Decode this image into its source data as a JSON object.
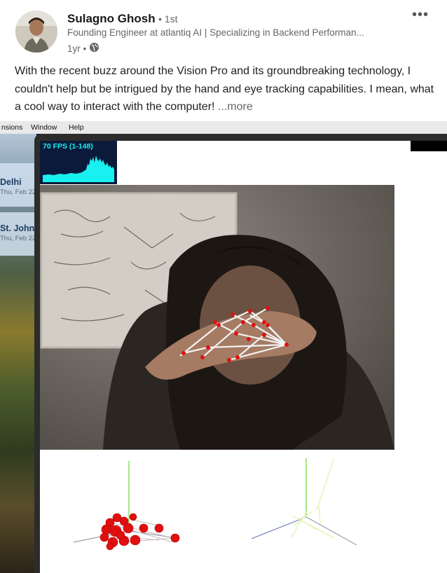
{
  "author": {
    "name": "Sulagno Ghosh",
    "degree": "• 1st",
    "headline": "Founding Engineer at atlantiq AI | Specializing in Backend Performan...",
    "time": "1yr •"
  },
  "post": {
    "text": "With the recent buzz around the Vision Pro and its groundbreaking technology, I couldn't help but be intrigued by the hand and eye tracking capabilities. I mean, what a cool way to interact with the computer!",
    "see_more": "...more"
  },
  "screen": {
    "menu": [
      "nsions",
      "Window",
      "Help"
    ],
    "weather": [
      {
        "city": "Delhi",
        "date": "Thu, Feb 22"
      },
      {
        "city": "St. John",
        "date": "Thu, Feb 22"
      }
    ],
    "fps_label": "70 FPS (1-148)",
    "fps_color": "#19f0f0",
    "landmark_color": "#e01010",
    "axis_colors": {
      "x": "#6c7fb8",
      "y": "#8be05a",
      "z": "#9aa0a8"
    }
  },
  "icons": {
    "globe": "globe-icon",
    "more": "more-options-icon"
  }
}
